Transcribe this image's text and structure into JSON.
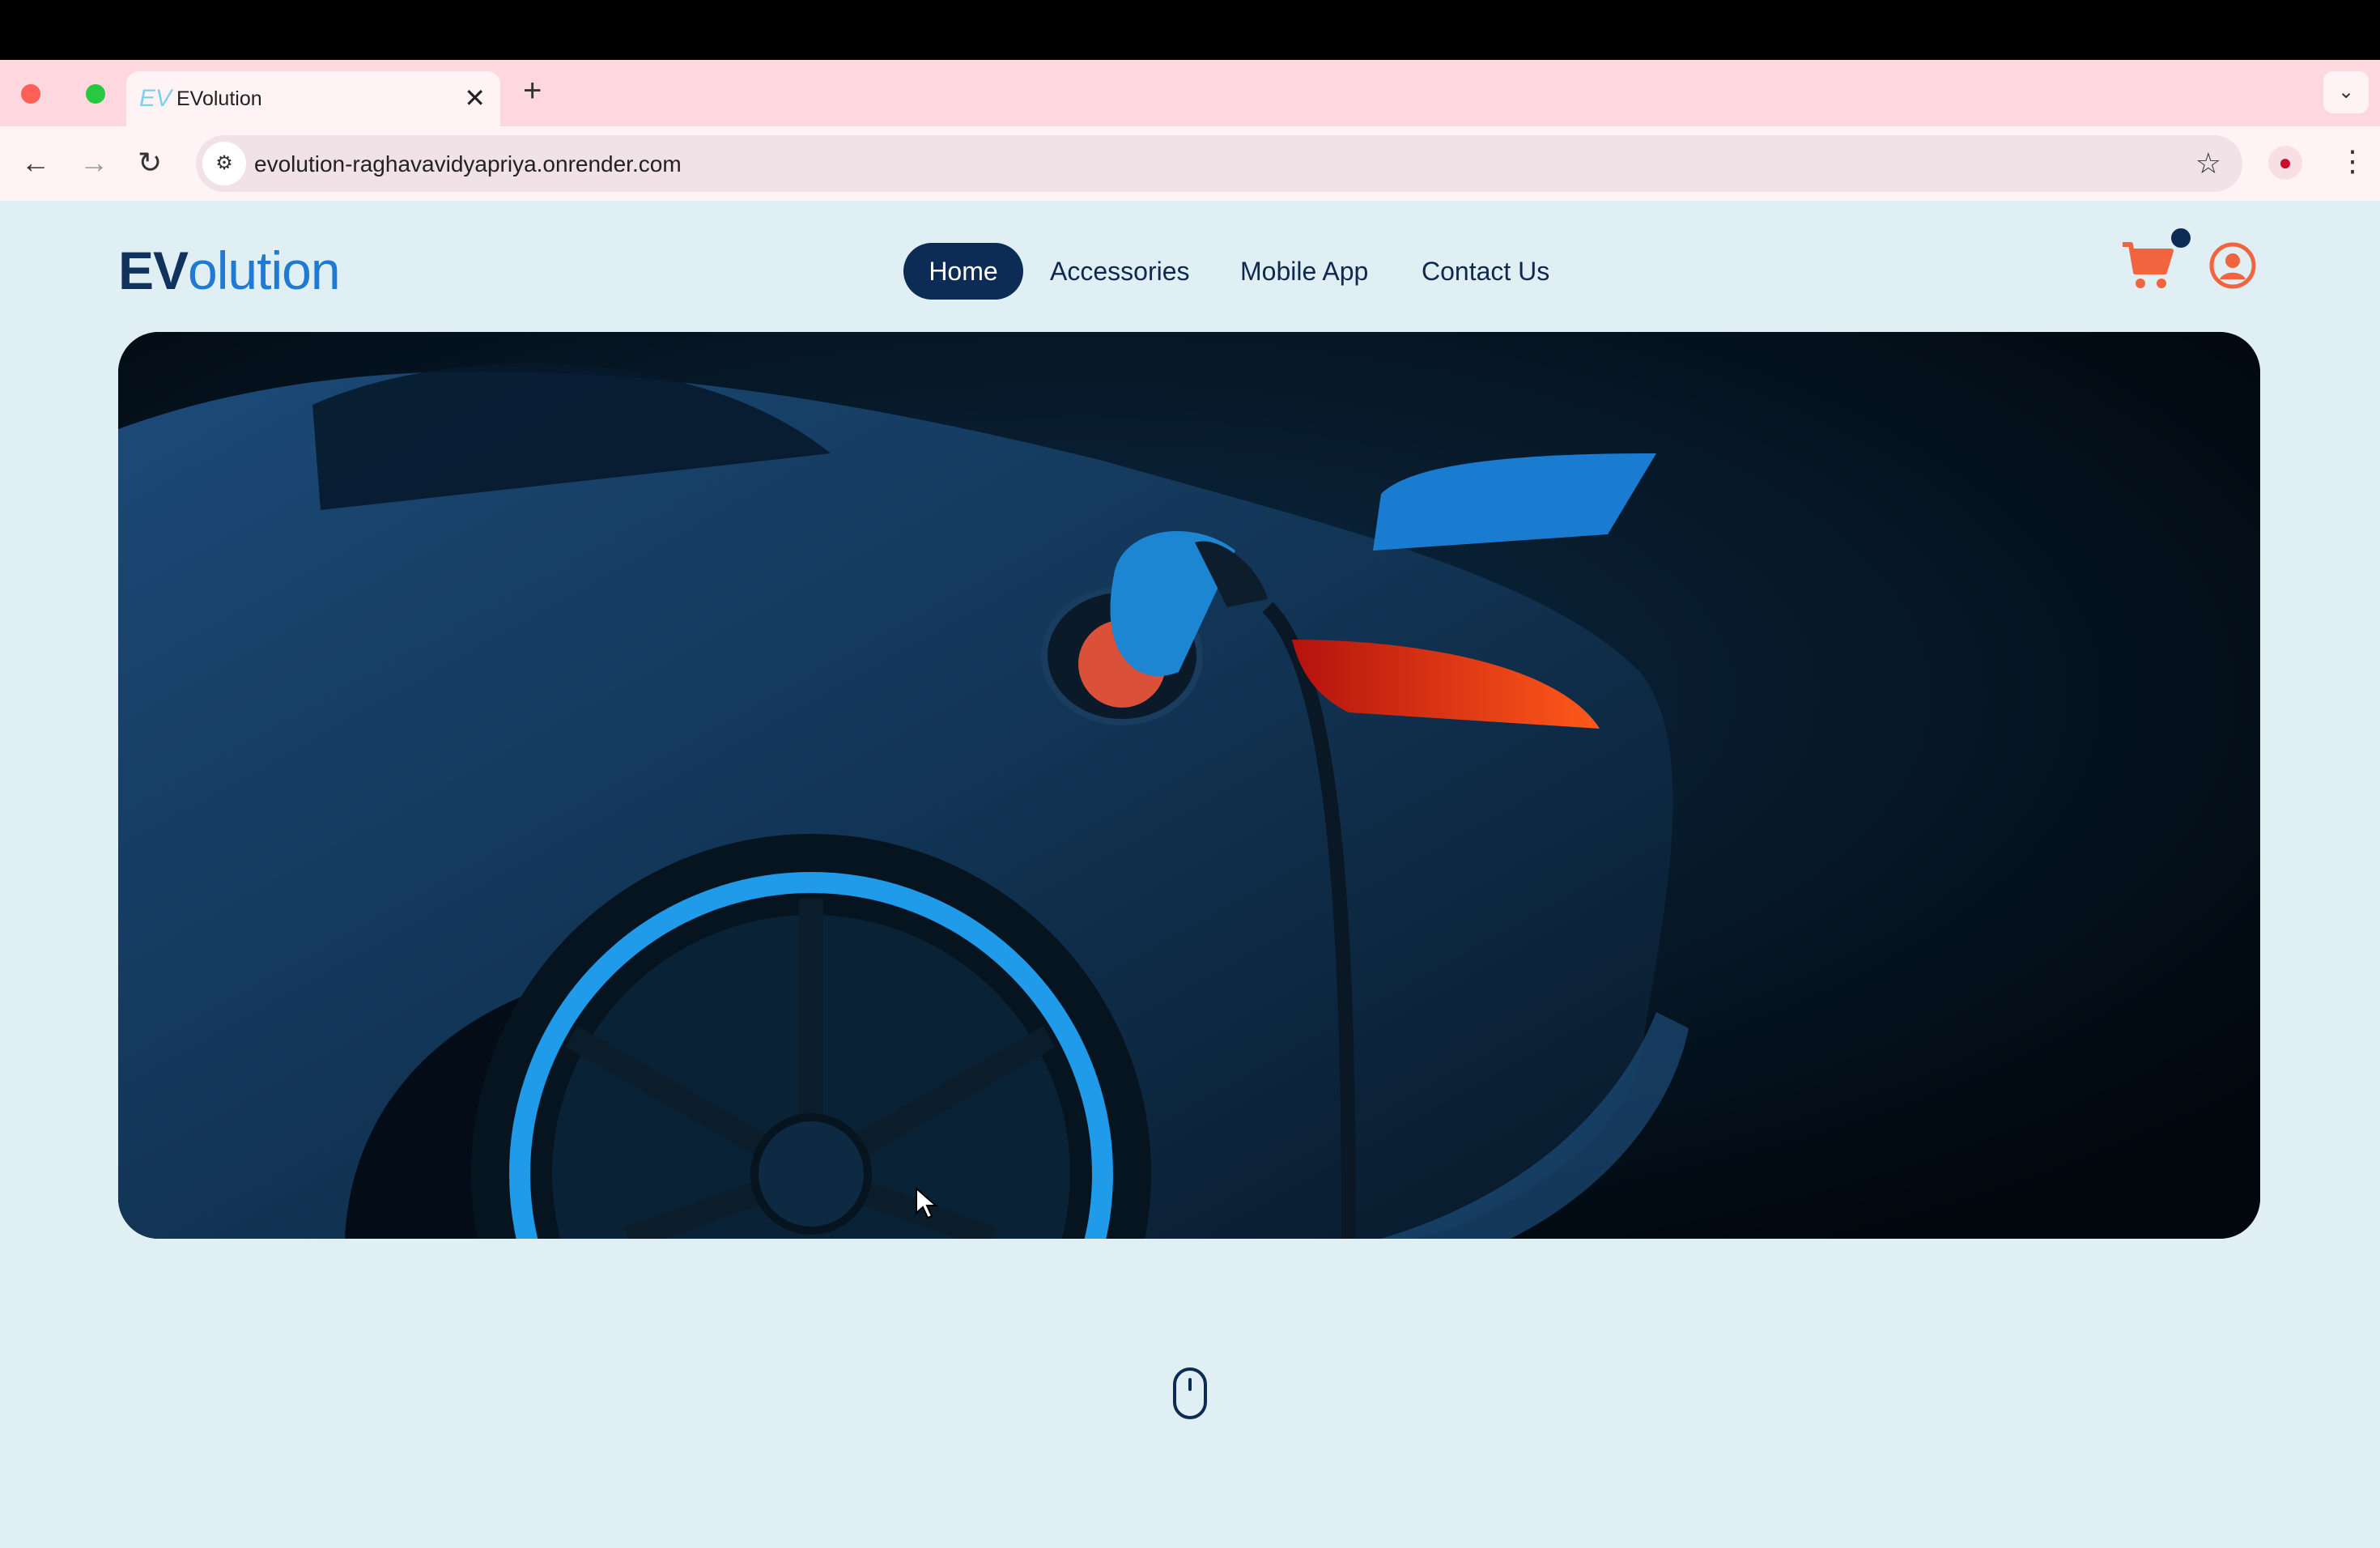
{
  "browser": {
    "tab": {
      "favicon": "EV",
      "title": "EVolution",
      "close_icon": "close-icon"
    },
    "new_tab_icon": "plus-icon",
    "address": {
      "url": "evolution-raghavavidyapriya.onrender.com"
    },
    "icons": [
      "back-arrow-icon",
      "forward-arrow-icon",
      "reload-icon",
      "site-info-icon",
      "bookmark-star-icon",
      "profile-icon",
      "menu-kebab-icon",
      "tab-search-chevron-icon"
    ]
  },
  "header": {
    "logo": {
      "part1": "EV",
      "part2": "olution"
    },
    "nav": [
      {
        "label": "Home",
        "active": true
      },
      {
        "label": "Accessories",
        "active": false
      },
      {
        "label": "Mobile App",
        "active": false
      },
      {
        "label": "Contact Us",
        "active": false
      }
    ],
    "cart_icon": "shopping-cart-icon",
    "user_icon": "user-account-icon"
  },
  "hero": {
    "image": "electric-sports-car-charging-photo"
  },
  "scroll_indicator": "mouse-scroll-icon",
  "colors": {
    "page_bg": "#e0eff4",
    "navy": "#0c2c56",
    "brand_blue": "#1e7ad2",
    "accent_coral": "#f2643f",
    "tabstrip": "#ffd7df"
  }
}
